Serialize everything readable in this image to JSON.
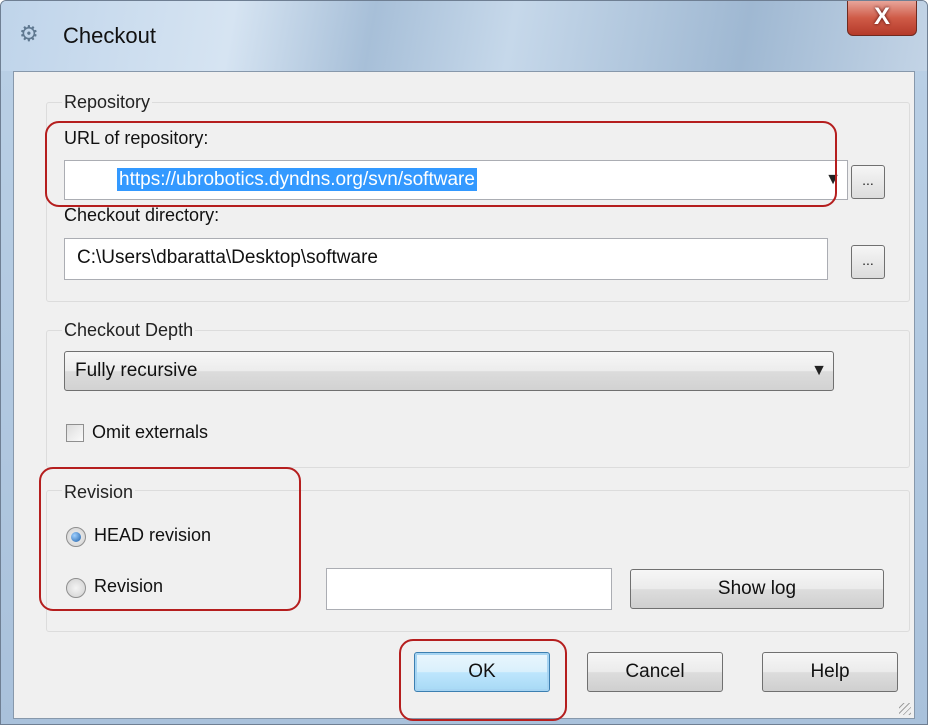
{
  "window": {
    "title": "Checkout",
    "close_glyph": "X"
  },
  "repository_group": {
    "label": "Repository",
    "url_label": "URL of repository:",
    "url_value": "https://ubrobotics.dyndns.org/svn/software",
    "dir_label": "Checkout directory:",
    "dir_value": "C:\\Users\\dbaratta\\Desktop\\software",
    "browse_label": "..."
  },
  "depth_group": {
    "label": "Checkout Depth",
    "depth_value": "Fully recursive",
    "omit_externals_label": "Omit externals",
    "omit_externals_checked": false
  },
  "revision_group": {
    "label": "Revision",
    "head_label": "HEAD revision",
    "revision_label": "Revision",
    "revision_value": "",
    "selected": "HEAD revision",
    "show_log_label": "Show log"
  },
  "buttons": {
    "ok": "OK",
    "cancel": "Cancel",
    "help": "Help"
  },
  "colors": {
    "highlight": "#b51e1e",
    "selection": "#3399ff"
  }
}
